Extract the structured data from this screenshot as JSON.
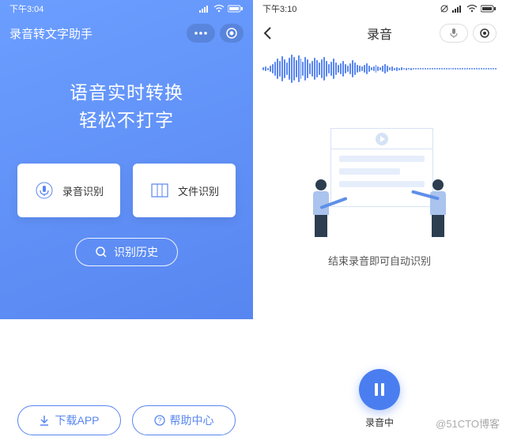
{
  "left": {
    "status_time": "下午3:04",
    "app_title": "录音转文字助手",
    "hero_line1": "语音实时转换",
    "hero_line2": "轻松不打字",
    "card_record": "录音识别",
    "card_file": "文件识别",
    "history_label": "识别历史",
    "download_label": "下载APP",
    "help_label": "帮助中心"
  },
  "right": {
    "status_time": "下午3:10",
    "title": "录音",
    "caption": "结束录音即可自动识别",
    "rec_status": "录音中"
  },
  "watermark": "@51CTO博客"
}
